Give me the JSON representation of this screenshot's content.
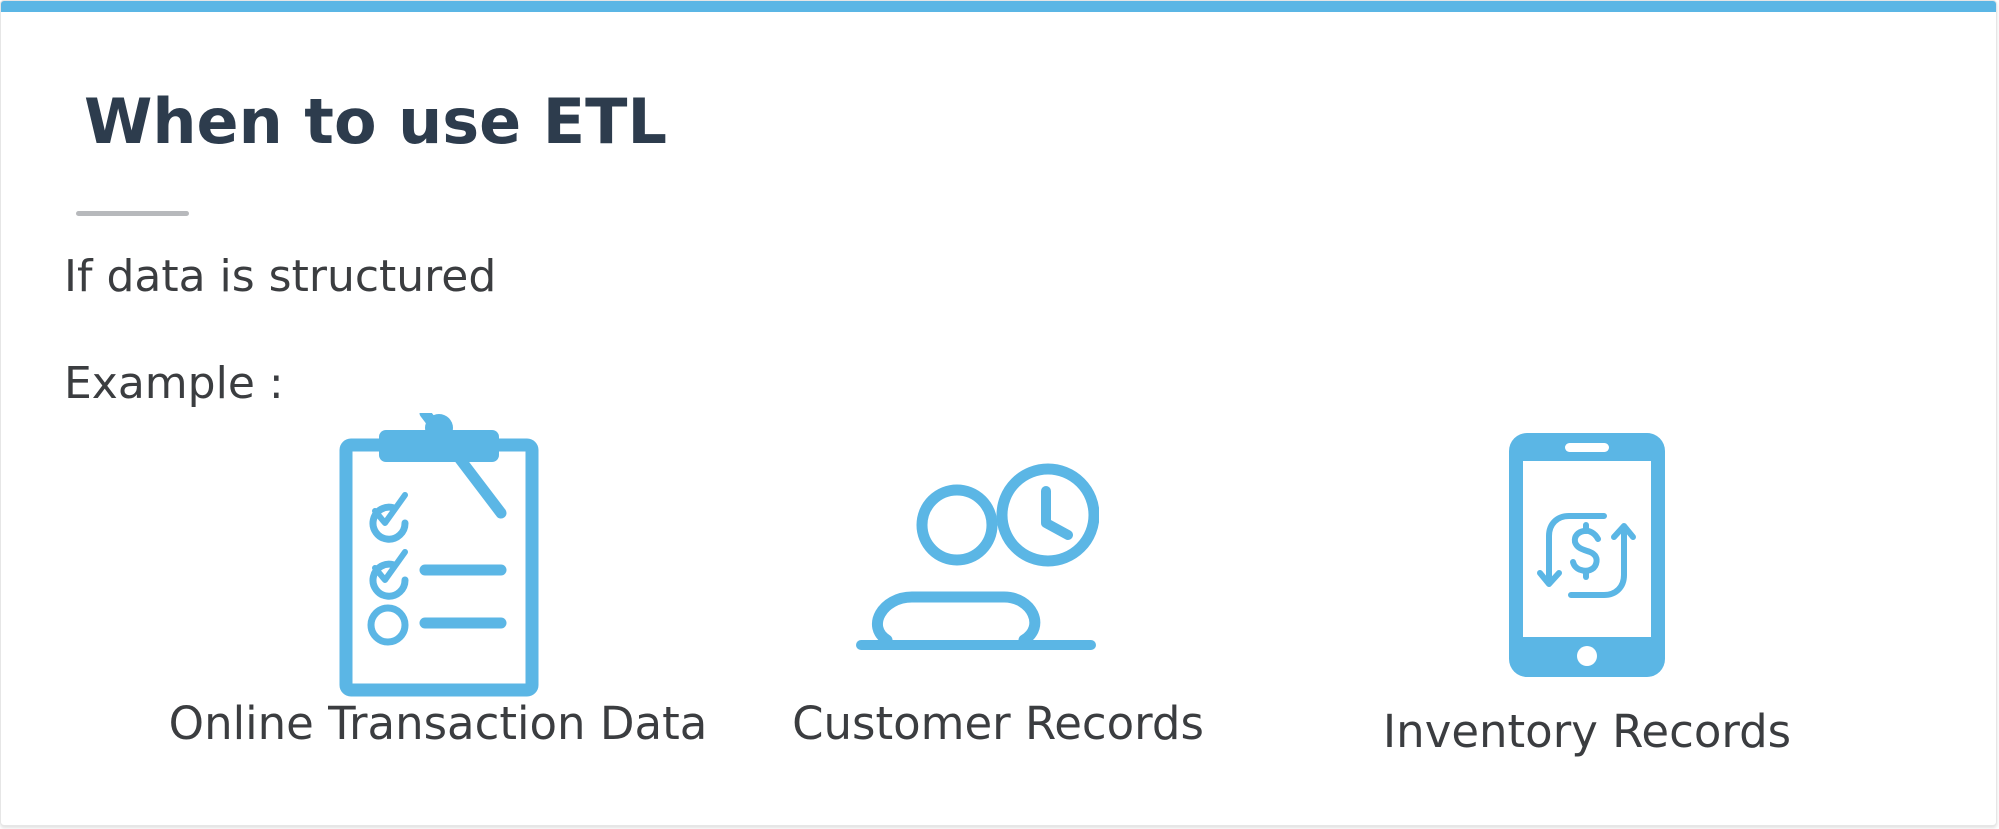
{
  "slide": {
    "title": "When to use ETL",
    "lines": [
      "If data is structured",
      "Example :"
    ],
    "examples": [
      {
        "label": "Online Transaction Data",
        "icon": "clipboard-checklist-icon"
      },
      {
        "label": "Customer Records",
        "icon": "person-clock-icon"
      },
      {
        "label": "Inventory Records",
        "icon": "mobile-payment-icon"
      }
    ]
  },
  "colors": {
    "accent": "#5bb6e5",
    "title": "#2d3c4d",
    "text": "#3b3d40",
    "underline": "#b7b9bc"
  }
}
